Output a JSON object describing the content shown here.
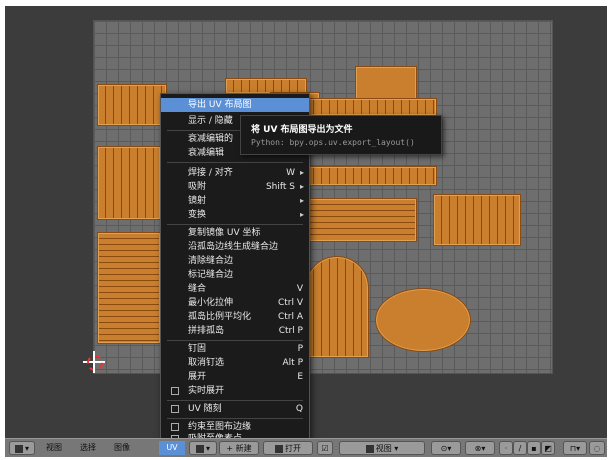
{
  "menu": {
    "items": [
      {
        "label": "导出 UV 布局图",
        "shortcut": "",
        "submenu": false,
        "highlighted": true
      },
      {
        "label": "显示 / 隐藏",
        "shortcut": "",
        "submenu": false
      },
      {
        "label": "衰减编辑的",
        "shortcut": "",
        "submenu": false
      },
      {
        "label": "衰减编辑",
        "shortcut": "",
        "submenu": false
      },
      {
        "label": "焊接 / 对齐",
        "shortcut": "W",
        "submenu": true
      },
      {
        "label": "吸附",
        "shortcut": "Shift S",
        "submenu": true
      },
      {
        "label": "镜射",
        "shortcut": "",
        "submenu": true
      },
      {
        "label": "变换",
        "shortcut": "",
        "submenu": true
      },
      {
        "label": "复制镜像 UV 坐标",
        "shortcut": "",
        "submenu": false
      },
      {
        "label": "沿孤岛边线生成缝合边",
        "shortcut": "",
        "submenu": false
      },
      {
        "label": "清除缝合边",
        "shortcut": "",
        "submenu": false
      },
      {
        "label": "标记缝合边",
        "shortcut": "",
        "submenu": false
      },
      {
        "label": "缝合",
        "shortcut": "V",
        "submenu": false
      },
      {
        "label": "最小化拉伸",
        "shortcut": "Ctrl V",
        "submenu": false
      },
      {
        "label": "孤岛比例平均化",
        "shortcut": "Ctrl A",
        "submenu": false
      },
      {
        "label": "拼排孤岛",
        "shortcut": "Ctrl P",
        "submenu": false
      },
      {
        "label": "钉固",
        "shortcut": "P",
        "submenu": false
      },
      {
        "label": "取消钉选",
        "shortcut": "Alt P",
        "submenu": false
      },
      {
        "label": "展开",
        "shortcut": "E",
        "submenu": false
      },
      {
        "label": "实时展开",
        "shortcut": "",
        "submenu": false,
        "checkbox": true
      },
      {
        "label": "UV 随刻",
        "shortcut": "Q",
        "submenu": false,
        "checkbox": true
      },
      {
        "label": "约束至图布边缘",
        "shortcut": "",
        "submenu": false,
        "checkbox": true
      },
      {
        "label": "吸附至像素点",
        "shortcut": "",
        "submenu": false,
        "checkbox": true
      }
    ]
  },
  "tooltip": {
    "title": "将 UV 布局图导出为文件",
    "python": "Python: bpy.ops.uv.export_layout()"
  },
  "header": {
    "view": "视图",
    "select": "选择",
    "image": "图像",
    "uvs": "UV",
    "new": "新建",
    "open": "打开",
    "view2": "视图"
  },
  "colors": {
    "highlight": "#5b8fd6",
    "island": "#c97f2e",
    "menu_bg": "#1b1b1b"
  }
}
